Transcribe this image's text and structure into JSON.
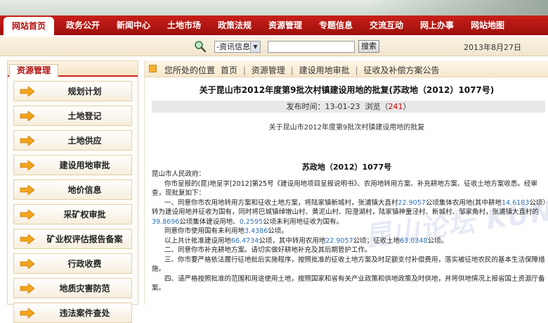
{
  "nav": {
    "items": [
      "网站首页",
      "政务公开",
      "新闻中心",
      "土地市场",
      "政策法规",
      "资源管理",
      "专题信息",
      "交流互动",
      "网上办事",
      "网站地图"
    ],
    "active_index": 0
  },
  "search": {
    "select_value": "-资讯信息-",
    "input_value": "",
    "button_label": "搜索",
    "date": "2013年8月27日"
  },
  "sidebar": {
    "title": "资源管理",
    "items": [
      "规划计划",
      "土地登记",
      "土地供应",
      "建设用地审批",
      "地价信息",
      "采矿权审批",
      "矿业权评估报告备案",
      "行政收费",
      "地质灾害防范",
      "违法案件查处"
    ]
  },
  "breadcrumb": {
    "prefix": "您所处的位置",
    "items": [
      "首页",
      "资源管理",
      "建设用地审批",
      "征收及补偿方案公告"
    ]
  },
  "article": {
    "title": "关于昆山市2012年度第9批次村镇建设用地的批复(苏政地（2012）1077号)",
    "publish_label": "发布时间：",
    "publish_date": "13-01-23",
    "views_label": "浏览（",
    "views": "241",
    "views_suffix": "）",
    "subtitle": "关于昆山市2012年度第9批次村镇建设用地的批复",
    "doc_number": "苏政地（2012）1077号",
    "watermark": "昆山论坛 KUNSHAN BBS",
    "p0": "昆山市人民政府：",
    "p1": "你市呈报的(昆)地呈字[2012]第25号《建设用地项目呈报说明书》、农用地转用方案、补充耕地方案、征收土地方案收悉。经审查，现批复如下：",
    "p2a": "一、同意你市农用地转用方案和征收土地方案，将陆家镇新城村，张浦镇大直村",
    "p2b": "22.9057",
    "p2c": "公顷集体农用地(其中耕地",
    "p2d": "14.6183",
    "p2e": "公顷）转为建设用地并征收为国有，同时将巴城镇绰墩山村、黄泥山村、阳澄湖村，陆家镇神童泾村、新城村、邹家角村，张浦镇大直村的",
    "p2f": "39.8696",
    "p2g": "公顷集体建设用地、",
    "p2h": "0.2595",
    "p2i": "公顷未利用地征收为国有。",
    "p3a": "同意你市使用国有未利用地",
    "p3b": "3.4386",
    "p3c": "公顷。",
    "p4a": "以上共计批准建设用地",
    "p4b": "66.4734",
    "p4c": "公顷，其中转用农用地",
    "p4d": "22.9057",
    "p4e": "公顷；征收土地",
    "p4f": "63.0348",
    "p4g": "公顷。",
    "p5": "二、同意你市补充耕地方案。请切实做好耕地补充及其后期管护工作。",
    "p6": "三、你市要严格依法履行征地批后实施程序，按照批准的征收土地方案及时足额支付补偿费用，落实被征地农民的基本生活保障措施。",
    "p7": "四、请严格按照批准的范围和用途使用土地，按照国家和省有关产业政策和供地政策及时供地，并将供地情况上报省国土资源厅备案。"
  }
}
